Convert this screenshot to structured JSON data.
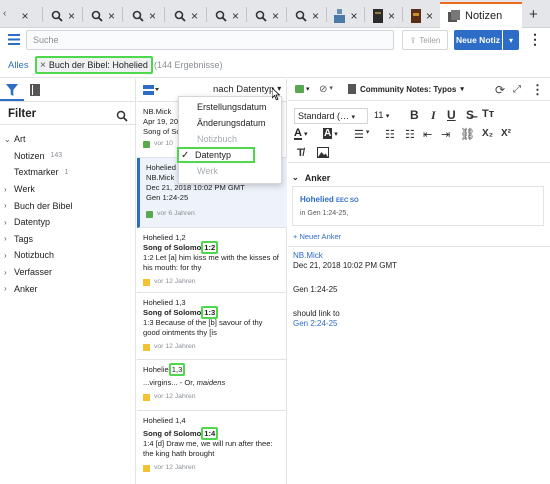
{
  "tabs": [
    {
      "icon": "search-icon"
    },
    {
      "icon": "search-icon"
    },
    {
      "icon": "search-icon"
    },
    {
      "icon": "search-icon"
    },
    {
      "icon": "search-icon"
    },
    {
      "icon": "search-icon"
    },
    {
      "icon": "search-icon"
    },
    {
      "icon": "book-stamp-icon"
    },
    {
      "icon": "book-dark-icon"
    },
    {
      "icon": "book-brown-icon"
    }
  ],
  "active_tab": {
    "label": "Notizen",
    "icon": "notes-icon"
  },
  "toolbar": {
    "search_placeholder": "Suche",
    "share_label": "Teilen",
    "new_note_label": "Neue Notiz"
  },
  "breadcrumb": {
    "all_label": "Alles",
    "chip_label": "Buch der Bibel: Hohelied",
    "count": "(144 Ergebnisse)"
  },
  "filter": {
    "title": "Filter",
    "items": [
      {
        "label": "Art",
        "expanded": true,
        "count": ""
      },
      {
        "label": "Notizen",
        "sub": true,
        "count": "143"
      },
      {
        "label": "Textmarker",
        "sub": true,
        "count": "1"
      },
      {
        "label": "Werk",
        "expanded": false,
        "count": ""
      },
      {
        "label": "Buch der Bibel",
        "expanded": false,
        "count": ""
      },
      {
        "label": "Datentyp",
        "expanded": false,
        "count": ""
      },
      {
        "label": "Tags",
        "expanded": false,
        "count": ""
      },
      {
        "label": "Notizbuch",
        "expanded": false,
        "count": ""
      },
      {
        "label": "Verfasser",
        "expanded": false,
        "count": ""
      },
      {
        "label": "Anker",
        "expanded": false,
        "count": ""
      }
    ]
  },
  "list": {
    "sort_label": "nach Datentyp",
    "sort_menu": [
      {
        "label": "Erstellungsdatum",
        "state": "normal"
      },
      {
        "label": "Änderungsdatum",
        "state": "normal"
      },
      {
        "label": "Notizbuch",
        "state": "disabled"
      },
      {
        "label": "Datentyp",
        "state": "checked"
      },
      {
        "label": "Werk",
        "state": "disabled"
      }
    ],
    "cards": [
      {
        "l1": "NB.Mick",
        "l2": "Apr 19, 20",
        "l3": "Song of Sc",
        "meta": "vor 10"
      },
      {
        "l1": "Hohelied s",
        "l2": "NB.Mick",
        "l3": "Dec 21, 2018 10:02 PM GMT",
        "l4": "Gen 1:24-25",
        "meta": "vor 6 Jahren"
      },
      {
        "head": "Hohelied 1,2",
        "title_pre": "Song of Solomo",
        "title_hl": "1:2",
        "body": "1:2 Let [a] him kiss me with the kisses of his mouth: for thy",
        "meta": "vor 12 Jahren"
      },
      {
        "head": "Hohelied 1,3",
        "title_pre": "Song of Solomo",
        "title_hl": "1:3",
        "body": "1:3 Because of the [b] savour of thy good ointments thy [is",
        "meta": "vor 12 Jahren"
      },
      {
        "head_pre": "Hohelie",
        "head_hl": "1,3",
        "body_pre": "...virgins... - Or, ",
        "body_em": "maidens",
        "meta": "vor 12 Jahren"
      },
      {
        "head": "Hohelied 1,4",
        "title_pre": "Song of Solomo",
        "title_hl": "1:4",
        "body": "1:4 [d] Draw me, we will run after thee: the king hath brought",
        "meta": "vor 12 Jahren"
      }
    ]
  },
  "editor": {
    "notebook_label": "Community Notes: Typos",
    "style_select": "Standard (…",
    "size_select": "11",
    "anker_heading": "Anker",
    "anker_title": "Hohelied",
    "anker_title_suffix": "EEC SO",
    "anker_sub": "in Gen 1:24-25,",
    "new_anchor": "+ Neuer Anker",
    "note_author": "NB.Mick",
    "note_date": "Dec 21, 2018 10:02 PM GMT",
    "note_ref": "Gen 1:24-25",
    "note_should": "should link to",
    "note_link": "Gen 2:24-25"
  },
  "colors": {
    "accent": "#2d6dc8",
    "highlight": "#4fd84d",
    "tab_active": "#ef6a1f",
    "note_yellow": "#f1c232"
  }
}
